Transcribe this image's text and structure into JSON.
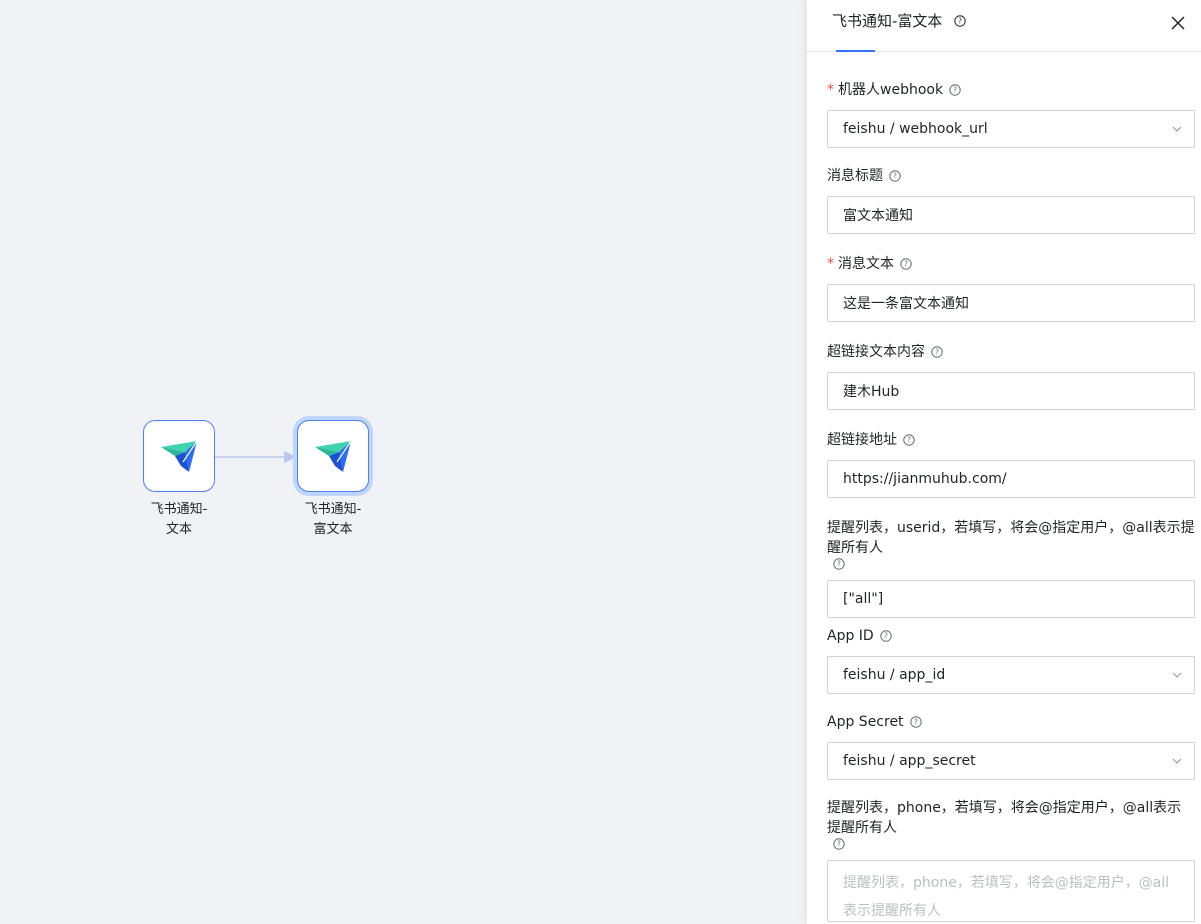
{
  "canvas": {
    "nodes": [
      {
        "label": "飞书通知-\n文本"
      },
      {
        "label": "飞书通知-\n富文本"
      }
    ]
  },
  "drawer": {
    "title": "飞书通知-富文本",
    "fields": [
      {
        "label": "机器人webhook",
        "required": true,
        "value": "feishu / webhook_url",
        "type": "select"
      },
      {
        "label": "消息标题",
        "required": false,
        "value": "富文本通知",
        "type": "input"
      },
      {
        "label": "消息文本",
        "required": true,
        "value": "这是一条富文本通知",
        "type": "input"
      },
      {
        "label": "超链接文本内容",
        "required": false,
        "value": "建木Hub",
        "type": "input"
      },
      {
        "label": "超链接地址",
        "required": false,
        "value": "https://jianmuhub.com/",
        "type": "input"
      },
      {
        "label": "提醒列表，userid，若填写，将会@指定用户，@all表示提醒所有人",
        "required": false,
        "value": "[\"all\"]",
        "type": "input"
      },
      {
        "label": "App ID",
        "required": false,
        "value": "feishu / app_id",
        "type": "select"
      },
      {
        "label": "App Secret",
        "required": false,
        "value": "feishu / app_secret",
        "type": "select"
      },
      {
        "label": "提醒列表，phone，若填写，将会@指定用户，@all表示提醒所有人",
        "required": false,
        "placeholder": "提醒列表，phone，若填写，将会@指定用户，@all表示提醒所有人",
        "type": "textarea"
      }
    ]
  },
  "colors": {
    "accent": "#3370ff",
    "required": "#f54a45",
    "canvas_bg": "#f0f2f5"
  }
}
